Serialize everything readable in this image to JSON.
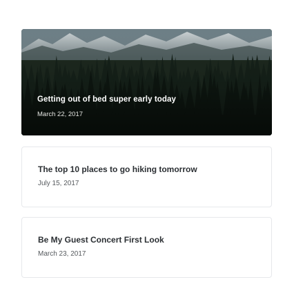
{
  "posts": [
    {
      "title": "Getting out of bed super early today",
      "date": "March 22, 2017",
      "featured": true,
      "image": "mountain-forest-photo"
    },
    {
      "title": "The top 10 places to go hiking tomorrow",
      "date": "July 15, 2017",
      "featured": false
    },
    {
      "title": "Be My Guest Concert First Look",
      "date": "March 23, 2017",
      "featured": false
    }
  ],
  "colors": {
    "page_background": "#ffffff",
    "card_border": "#e6e8eb",
    "title_text": "#2b2f33",
    "date_text": "#55595d",
    "hero_title_text": "#ffffff"
  }
}
